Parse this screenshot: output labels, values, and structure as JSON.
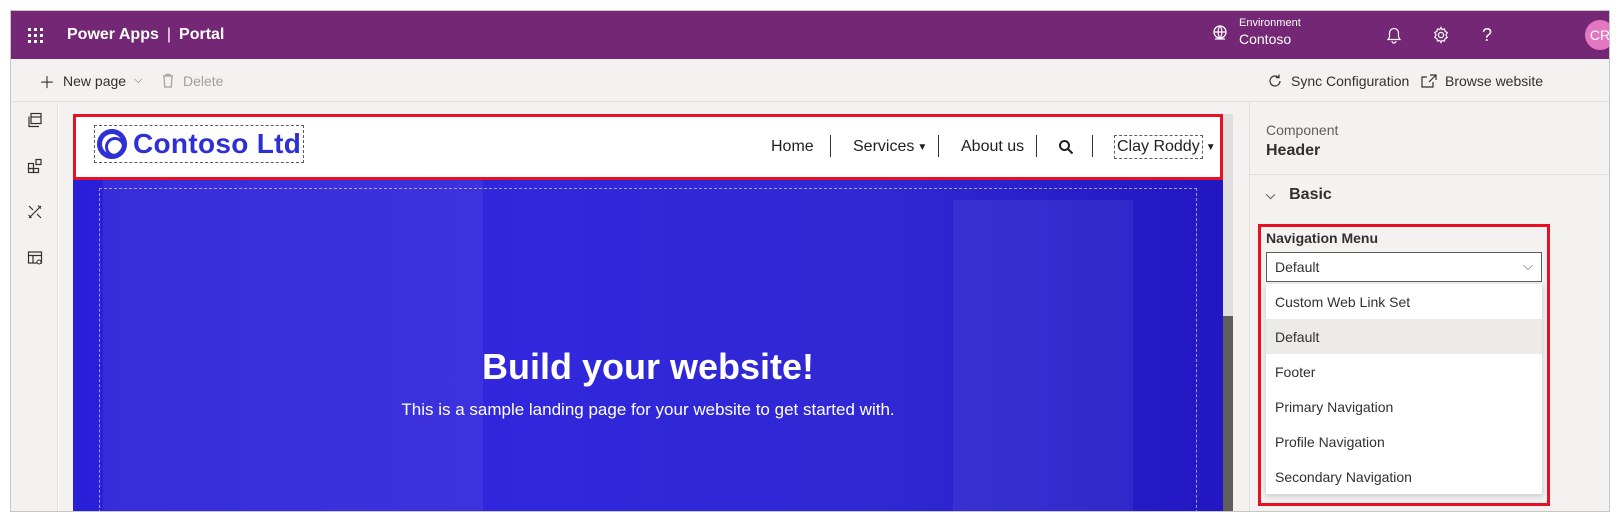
{
  "topbar": {
    "app_name": "Power Apps",
    "separator": "|",
    "section": "Portal",
    "environment_label": "Environment",
    "environment_value": "Contoso",
    "avatar_initials": "CR",
    "icons": [
      "waffle-icon",
      "environment-icon",
      "bell-icon",
      "gear-icon",
      "help-icon"
    ],
    "color": "#742774"
  },
  "commands": {
    "new_page": "New page",
    "delete": "Delete",
    "sync": "Sync Configuration",
    "browse": "Browse website"
  },
  "rail": {
    "icons": [
      "pages-icon",
      "components-icon",
      "themes-icon",
      "templates-icon"
    ]
  },
  "site": {
    "logo_text": "Contoso Ltd",
    "nav": [
      "Home",
      "Services",
      "About us"
    ],
    "user": "Clay Roddy",
    "hero_title": "Build your website!",
    "hero_subtitle": "This is a sample landing page for your website to get started with.",
    "accent": "#2f2fd6"
  },
  "panel": {
    "component_label": "Component",
    "component_value": "Header",
    "section": "Basic",
    "nav_menu_label": "Navigation Menu",
    "nav_menu_selected": "Default",
    "options": [
      "Custom Web Link Set",
      "Default",
      "Footer",
      "Primary Navigation",
      "Profile Navigation",
      "Secondary Navigation"
    ],
    "highlight_color": "#e81123"
  }
}
